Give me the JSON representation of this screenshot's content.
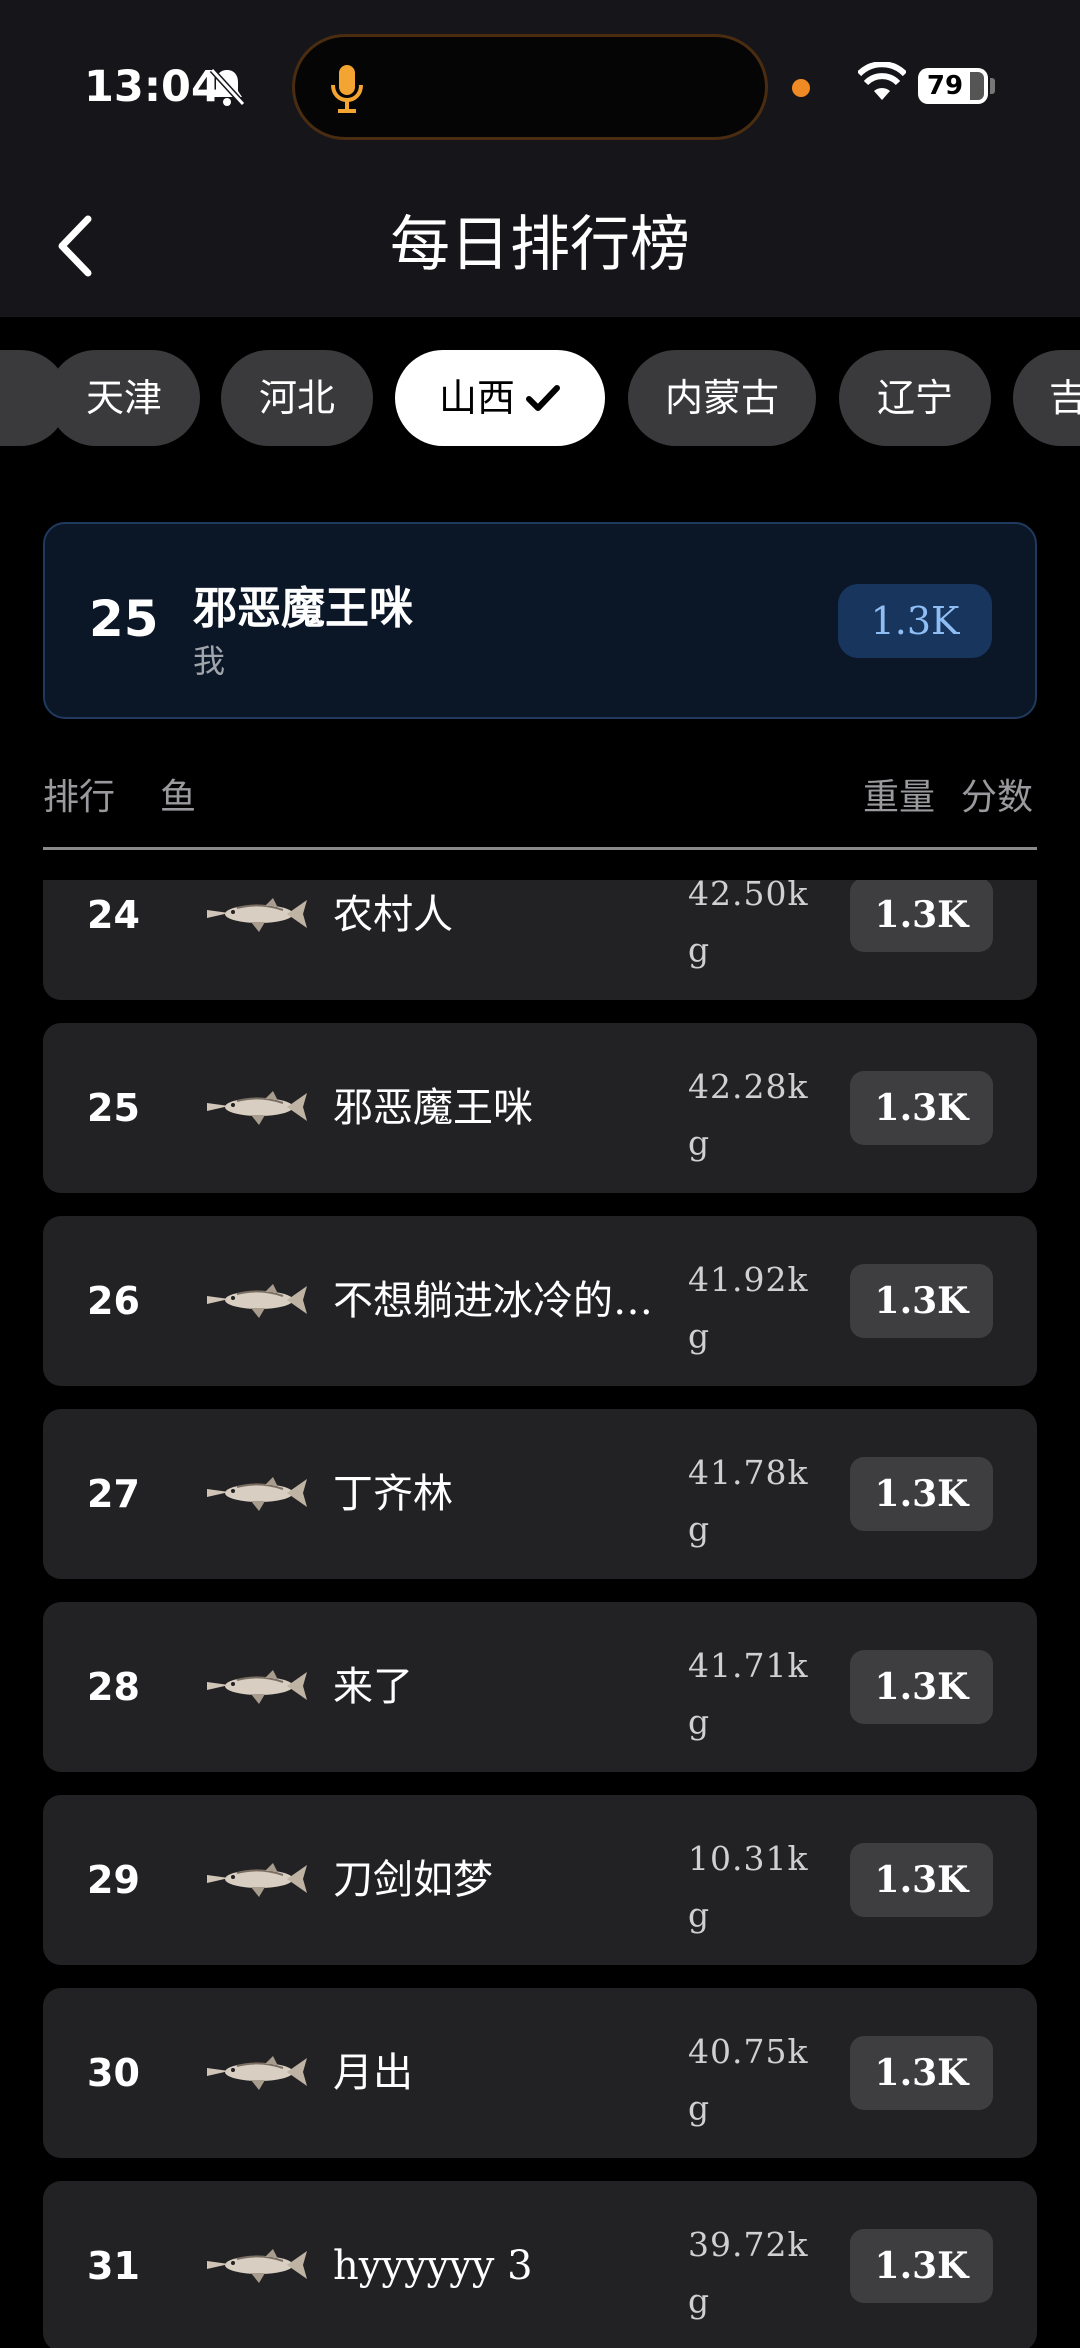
{
  "status_bar": {
    "time": "13:04",
    "battery": "79",
    "icons": [
      "bell-off-icon",
      "mic-icon",
      "wifi-icon",
      "battery-icon"
    ]
  },
  "header": {
    "title": "每日排行榜",
    "back_icon": "chevron-left-icon"
  },
  "provinces": [
    {
      "label": ""
    },
    {
      "label": "天津"
    },
    {
      "label": "河北"
    },
    {
      "label": "山西",
      "selected": true
    },
    {
      "label": "内蒙古"
    },
    {
      "label": "辽宁"
    },
    {
      "label": "吉"
    }
  ],
  "my_rank": {
    "rank": "25",
    "name": "邪恶魔王咪",
    "subtitle": "我",
    "score": "1.3K"
  },
  "columns": {
    "rank": "排行",
    "fish": "鱼",
    "weight": "重量",
    "score": "分数"
  },
  "rows": [
    {
      "rank": "24",
      "name": "农村人",
      "weight": "42.50kg",
      "score": "1.3K"
    },
    {
      "rank": "25",
      "name": "邪恶魔王咪",
      "weight": "42.28kg",
      "score": "1.3K"
    },
    {
      "rank": "26",
      "name": "不想躺进冰冷的…",
      "weight": "41.92kg",
      "score": "1.3K"
    },
    {
      "rank": "27",
      "name": "丁齐林",
      "weight": "41.78kg",
      "score": "1.3K"
    },
    {
      "rank": "28",
      "name": "来了",
      "weight": "41.71kg",
      "score": "1.3K"
    },
    {
      "rank": "29",
      "name": "刀剑如梦",
      "weight": "10.31kg",
      "score": "1.3K"
    },
    {
      "rank": "30",
      "name": "月出",
      "weight": "40.75kg",
      "score": "1.3K"
    },
    {
      "rank": "31",
      "name": "hyyyyyy 3",
      "weight": "39.72kg",
      "score": "1.3K"
    }
  ],
  "colors": {
    "background": "#000000",
    "card": "#222224",
    "my_card": "#0b1627",
    "my_score": "#8fbef5",
    "chip": "#3a3a3c",
    "accent_orange": "#f08a24"
  }
}
